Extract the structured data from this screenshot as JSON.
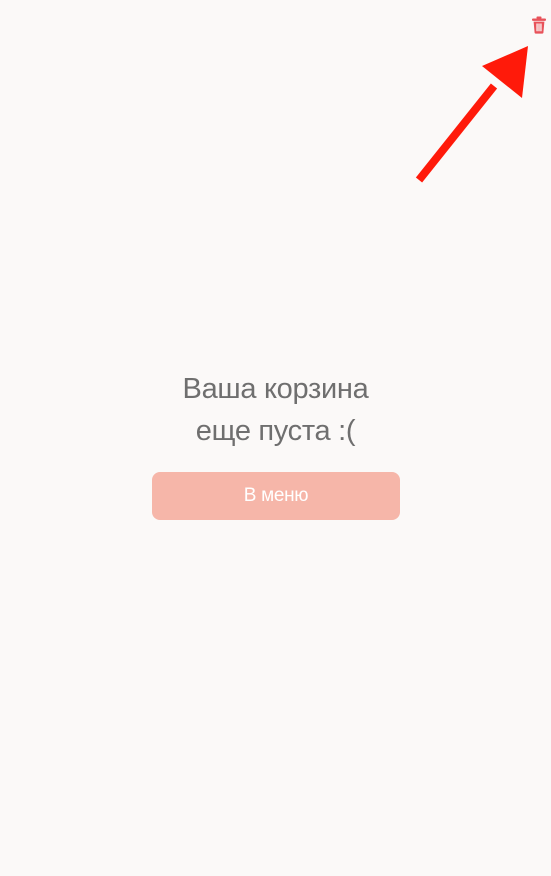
{
  "header": {
    "clear_cart_icon": "trash-icon"
  },
  "empty_state": {
    "line1": "Ваша корзина",
    "line2": "еще пуста :("
  },
  "actions": {
    "menu_button_label": "В меню"
  },
  "colors": {
    "background": "#fbf9f8",
    "trash_icon": "#e8525a",
    "annotation_arrow": "#ff1a0a",
    "button_bg": "#f6b6a9",
    "button_text": "#ffffff",
    "message_text": "#6f6f6f"
  }
}
